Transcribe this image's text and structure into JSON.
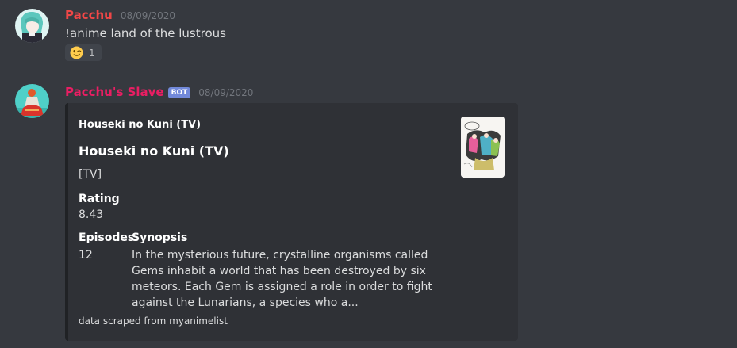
{
  "messages": [
    {
      "username": "Pacchu",
      "username_color": "#f04747",
      "timestamp": "08/09/2020",
      "text": "!anime land of the lustrous",
      "reaction": {
        "emoji": "winking-face-emoji",
        "count": "1"
      }
    },
    {
      "username": "Pacchu's Slave",
      "username_color": "#e91e63",
      "bot_tag": "BOT",
      "timestamp": "08/09/2020",
      "embed": {
        "author": "Houseki no Kuni (TV)",
        "title": "Houseki no Kuni (TV)",
        "description": "[TV]",
        "fields": {
          "rating": {
            "name": "Rating",
            "value": "8.43"
          },
          "episodes": {
            "name": "Episodes",
            "value": "12"
          },
          "synopsis": {
            "name": "Synopsis",
            "value": "In the mysterious future, crystalline organisms called Gems inhabit a world that has been destroyed by six meteors. Each Gem is assigned a role in order to fight against the Lunarians, a species who a..."
          }
        },
        "footer": "data scraped from myanimelist",
        "thumbnail": "anime-poster-thumbnail"
      }
    }
  ]
}
